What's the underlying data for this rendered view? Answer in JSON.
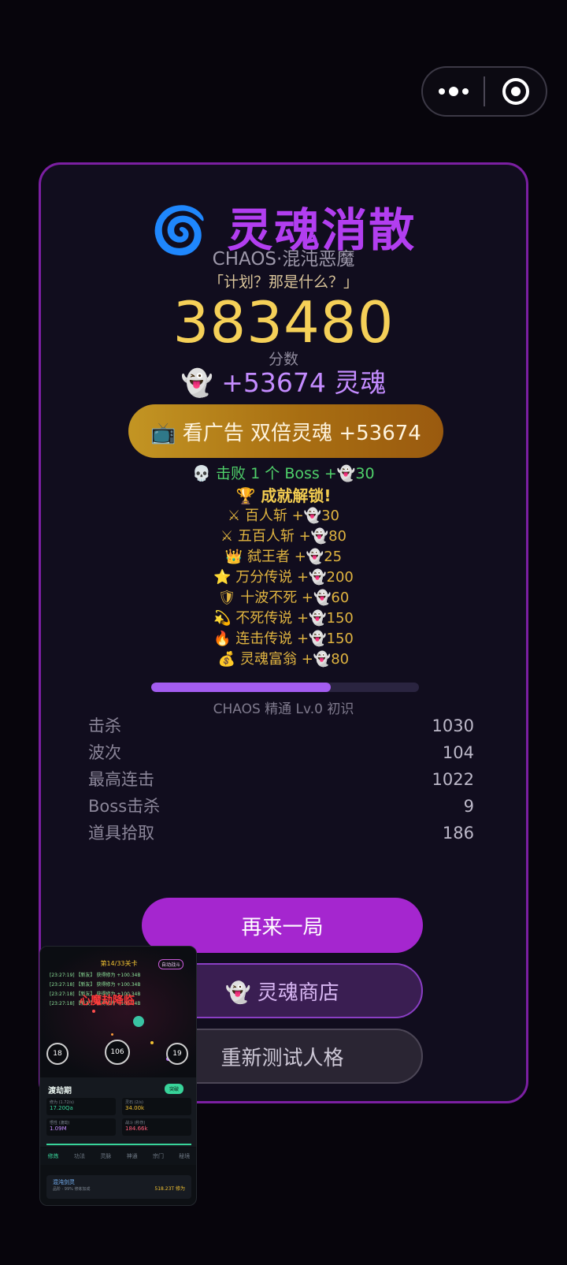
{
  "capsule": {
    "more_icon": "more-dots-icon",
    "close_icon": "target-circle-icon"
  },
  "result": {
    "title": "🌀 灵魂消散",
    "character": "CHAOS·混沌恶魔",
    "quote": "「计划？那是什么？」",
    "score": "383480",
    "score_label": "分数",
    "souls_earned": "👻 +53674 灵魂",
    "ad_button": "📺 看广告 双倍灵魂 +53674",
    "boss_bonus": "💀 击败 1 个 Boss +👻30",
    "achievements_header": "🏆 成就解锁!",
    "achievements": [
      "⚔ 百人斩 +👻30",
      "⚔ 五百人斩 +👻80",
      "👑 弑王者 +👻25",
      "⭐ 万分传说 +👻200",
      "🛡 十波不死 +👻60",
      "💫 不死传说 +👻150",
      "🔥 连击传说 +👻150",
      "💰 灵魂富翁 +👻80"
    ],
    "mastery_progress": 0.67,
    "mastery_label": "CHAOS 精通 Lv.0 初识",
    "stats": [
      {
        "label": "击杀",
        "value": "1030"
      },
      {
        "label": "波次",
        "value": "104"
      },
      {
        "label": "最高连击",
        "value": "1022"
      },
      {
        "label": "Boss击杀",
        "value": "9"
      },
      {
        "label": "道具拾取",
        "value": "186"
      }
    ],
    "buttons": {
      "play_again": "再来一局",
      "soul_shop": "👻 灵魂商店",
      "retest": "重新测试人格"
    }
  },
  "preview": {
    "header": "第14/33关卡",
    "mode": "自动战斗",
    "log": [
      "[23:27:19] 【新友】 获得修为 +100.34B",
      "[23:27:18] 【新友】 获得修为 +100.34B",
      "[23:27:18] 【新友】 获得修为 +100.34B",
      "[23:27:18] 【新友】 获得修为 +100.34B"
    ],
    "banner": "心魔劫降临",
    "orbs": [
      "18",
      "106",
      "19"
    ],
    "phase": "渡劫期",
    "phase_badge": "突破",
    "cells": [
      {
        "label": "修为 (1.72/s)",
        "value": "17.20Qa"
      },
      {
        "label": "灵石 (2/s)",
        "value": "34.00k"
      },
      {
        "label": "悟性 (渡劫)",
        "value": "1.09M"
      },
      {
        "label": "战斗 (秒伤)",
        "value": "184.66k"
      }
    ],
    "tabs": [
      "修炼",
      "功法",
      "灵脉",
      "神通",
      "宗门",
      "秘境"
    ],
    "item_name": "混沌剑灵",
    "item_desc": "品阶 · 99% 修炼加成",
    "item_rate": "518.23T 修为"
  }
}
